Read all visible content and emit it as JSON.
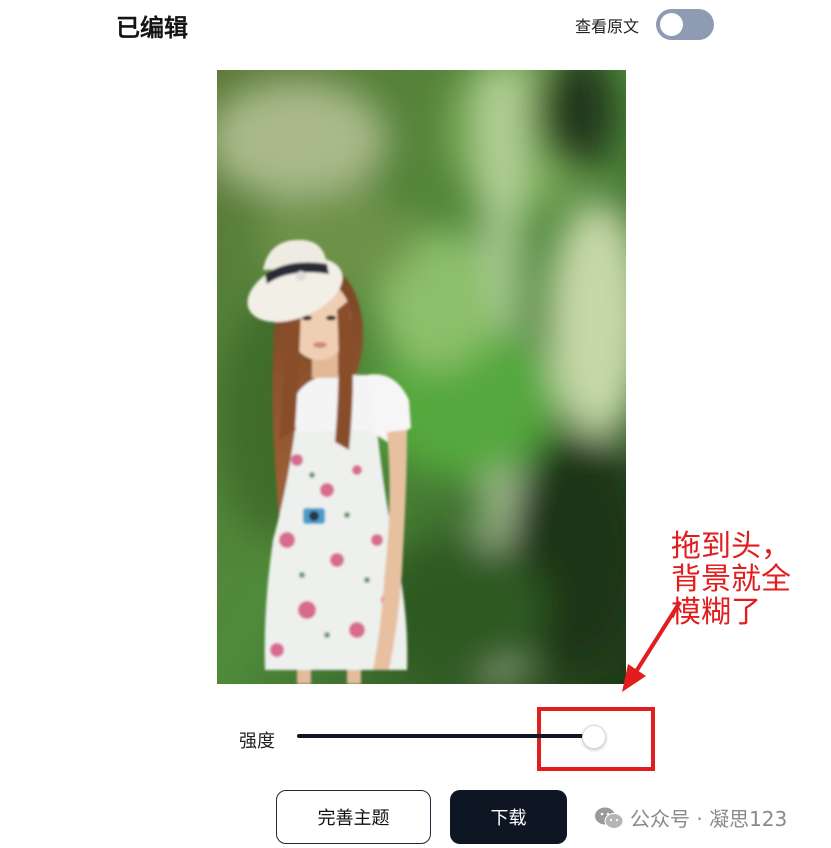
{
  "header": {
    "title": "已编辑",
    "view_original_label": "查看原文"
  },
  "annotation": {
    "lines": [
      "拖到头，",
      "背景就全",
      "模糊了"
    ]
  },
  "slider": {
    "label": "强度",
    "value_percent": 100
  },
  "buttons": {
    "improve": "完善主题",
    "download": "下载"
  },
  "watermark": {
    "text": "公众号 · 凝思123"
  },
  "colors": {
    "accent_red": "#e11d1d",
    "dark_button": "#0e1623",
    "toggle_off": "#8f9bb3"
  }
}
